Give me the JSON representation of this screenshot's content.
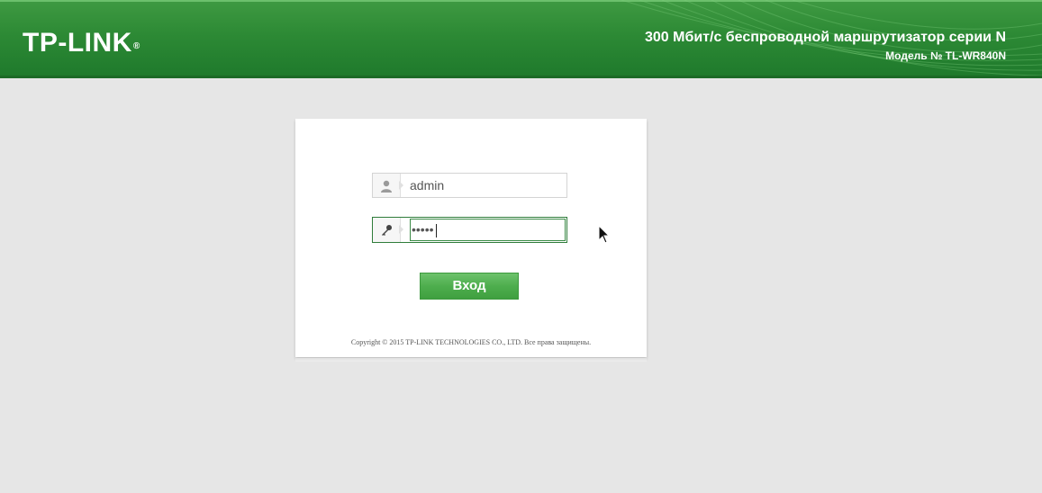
{
  "header": {
    "logo_text": "TP-LINK",
    "logo_reg": "®",
    "title": "300 Мбит/с беспроводной маршрутизатор серии N",
    "model": "Модель № TL-WR840N"
  },
  "login": {
    "username_value": "admin",
    "password_masked": "•••••",
    "submit_label": "Вход",
    "copyright": "Copyright © 2015 TP-LINK TECHNOLOGIES CO., LTD. Все права защищены."
  },
  "icons": {
    "user": "user-icon",
    "password": "key-icon",
    "cursor": "mouse-cursor-icon"
  },
  "colors": {
    "header_green": "#2d8a35",
    "button_green": "#4eae4e",
    "background": "#e6e6e6"
  }
}
